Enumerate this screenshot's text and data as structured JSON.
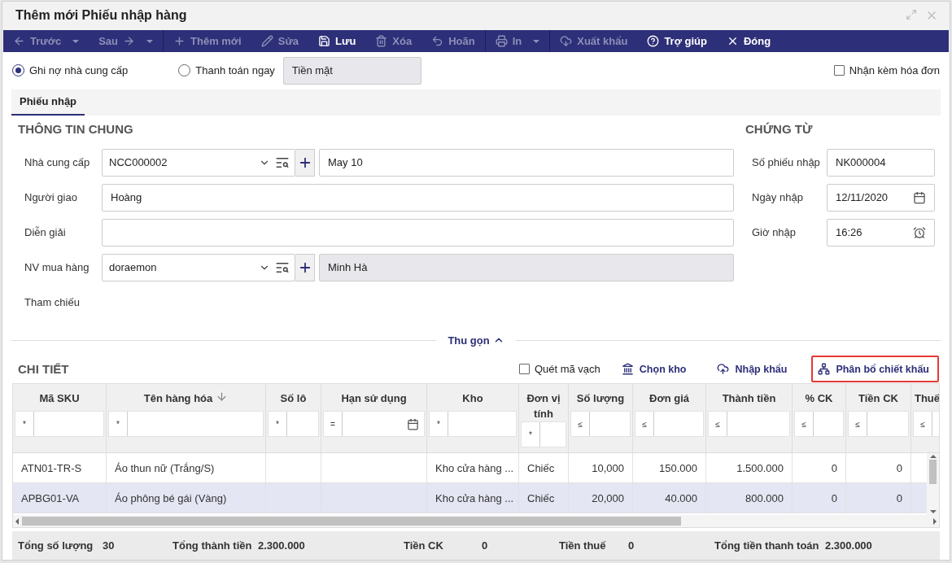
{
  "window": {
    "title": "Thêm mới Phiếu nhập hàng"
  },
  "toolbar": [
    [
      {
        "label": "Trước",
        "dropdown": true,
        "disabled": true
      },
      {
        "label": "Sau",
        "dropdown": true,
        "disabled": true
      }
    ],
    [
      {
        "label": "Thêm mới",
        "dropdown": false,
        "disabled": true
      },
      {
        "label": "Sửa",
        "dropdown": false,
        "disabled": true
      },
      {
        "label": "Lưu",
        "dropdown": false,
        "disabled": false
      },
      {
        "label": "Xóa",
        "dropdown": false,
        "disabled": true
      },
      {
        "label": "Hoãn",
        "dropdown": false,
        "disabled": true
      }
    ],
    [
      {
        "label": "In",
        "dropdown": true,
        "disabled": true
      }
    ],
    [
      {
        "label": "Xuất khẩu",
        "dropdown": false,
        "disabled": true
      },
      {
        "label": "Trợ giúp",
        "dropdown": false,
        "disabled": false
      },
      {
        "label": "Đóng",
        "dropdown": false,
        "disabled": false
      }
    ]
  ],
  "payment": {
    "options": [
      {
        "label": "Ghi nợ nhà cung cấp",
        "selected": true
      },
      {
        "label": "Thanh toán ngay",
        "selected": false
      }
    ],
    "method": {
      "value": "Tiền mặt",
      "disabled": true
    },
    "invoice": {
      "label": "Nhận kèm hóa đơn",
      "checked": false
    }
  },
  "tabs": [
    {
      "label": "Phiếu nhập",
      "selected": true
    }
  ],
  "general": {
    "title": "THÔNG TIN CHUNG",
    "fields": [
      {
        "kind": "lookup",
        "label": "Nhà cung cấp",
        "value": "NCC000002",
        "name_value": "May 10",
        "name_disabled": false
      },
      {
        "kind": "text",
        "label": "Người giao",
        "value": "Hoàng"
      },
      {
        "kind": "text",
        "label": "Diễn giải"
      },
      {
        "kind": "lookup",
        "label": "NV mua hàng",
        "value": "doraemon",
        "name_value": "Minh Hà",
        "name_disabled": true
      },
      {
        "kind": "label",
        "label": "Tham chiếu"
      }
    ]
  },
  "voucher": {
    "title": "CHỨNG TỪ",
    "fields": [
      {
        "kind": "text",
        "label": "Số phiếu nhập",
        "value": "NK000004"
      },
      {
        "kind": "date",
        "label": "Ngày nhập",
        "value": "12/11/2020"
      },
      {
        "kind": "time",
        "label": "Giờ nhập",
        "value": "16:26"
      }
    ]
  },
  "collapse": {
    "label": "Thu gọn",
    "expanded": true
  },
  "detail": {
    "title": "CHI TIẾT",
    "barcode": {
      "label": "Quét mã vạch",
      "checked": false
    },
    "actions": [
      {
        "label": "Chọn kho",
        "highlighted": false
      },
      {
        "label": "Nhập khẩu",
        "highlighted": false
      },
      {
        "label": "Phân bổ chiết khấu",
        "highlighted": true
      }
    ],
    "columns": [
      {
        "label": "Mã SKU",
        "kind": "text",
        "filter": "*",
        "sorted": false
      },
      {
        "label": "Tên hàng hóa",
        "kind": "text",
        "filter": "*",
        "sorted": true
      },
      {
        "label": "Số lô",
        "kind": "text",
        "filter": "*",
        "sorted": false
      },
      {
        "label": "Hạn sử dụng",
        "kind": "date",
        "filter": "=",
        "sorted": false
      },
      {
        "label": "Kho",
        "kind": "text",
        "filter": "*",
        "sorted": false
      },
      {
        "label": "Đơn vị tính",
        "kind": "text",
        "filter": "*",
        "sorted": false
      },
      {
        "label": "Số lượng",
        "kind": "number",
        "filter": "≤",
        "sorted": false
      },
      {
        "label": "Đơn giá",
        "kind": "number",
        "filter": "≤",
        "sorted": false
      },
      {
        "label": "Thành tiền",
        "kind": "number",
        "filter": "≤",
        "sorted": false
      },
      {
        "label": "% CK",
        "kind": "number",
        "filter": "≤",
        "sorted": false
      },
      {
        "label": "Tiền CK",
        "kind": "number",
        "filter": "≤",
        "sorted": false
      },
      {
        "label": "Thuế",
        "kind": "number",
        "filter": "≤",
        "sorted": false
      }
    ],
    "rows": [
      {
        "selected": false,
        "cells": [
          "ATN01-TR-S",
          "Áo thun nữ (Trắng/S)",
          null,
          null,
          "Kho cửa hàng ...",
          "Chiếc",
          "10,000",
          "150.000",
          "1.500.000",
          "0",
          "0"
        ]
      },
      {
        "selected": true,
        "cells": [
          "APBG01-VA",
          "Áo phông bé gái (Vàng)",
          null,
          null,
          "Kho cửa hàng ...",
          "Chiếc",
          "20,000",
          "40.000",
          "800.000",
          "0",
          "0"
        ]
      }
    ]
  },
  "totals": [
    {
      "label": "Tổng số lượng",
      "value": "30"
    },
    {
      "label": "Tổng thành tiền",
      "value": "2.300.000"
    },
    {
      "label": "Tiền CK",
      "value": "0"
    },
    {
      "label": "Tiền thuế",
      "value": "0"
    },
    {
      "label": "Tổng tiền thanh toán",
      "value": "2.300.000"
    }
  ]
}
